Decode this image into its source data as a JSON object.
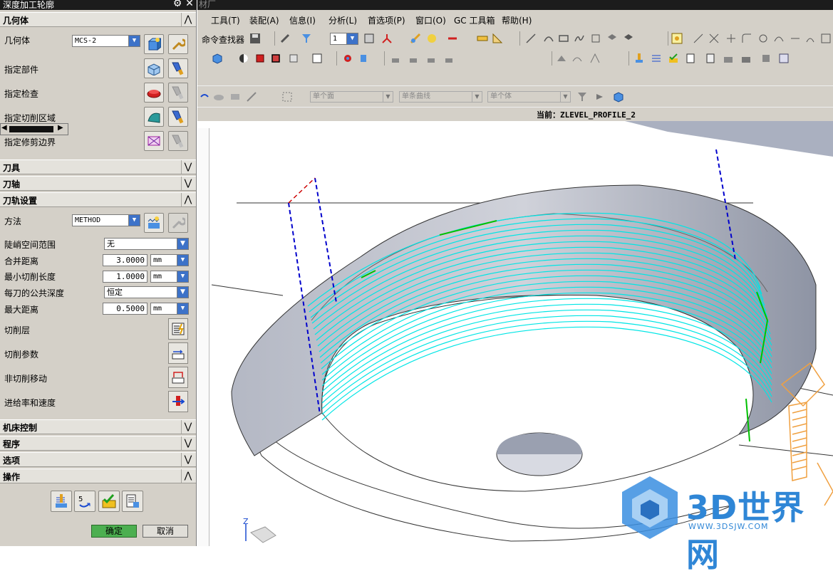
{
  "app": {
    "window_title": "材厂",
    "dialog_title": "深度加工轮廓"
  },
  "menu": [
    "工具(T)",
    "装配(A)",
    "信息(I)",
    "分析(L)",
    "首选项(P)",
    "窗口(O)",
    "GC 工具箱",
    "帮助(H)"
  ],
  "toolbar": {
    "command_finder": "命令查找器",
    "layer_value": "1",
    "selection_filters": [
      "单个面",
      "单条曲线",
      "单个体"
    ]
  },
  "status": {
    "current_operation": "当前：ZLEVEL_PROFILE_2"
  },
  "dialog": {
    "sections": {
      "geometry": "几何体",
      "tool": "刀具",
      "tool_axis": "刀轴",
      "path_settings": "刀轨设置",
      "machine_control": "机床控制",
      "program": "程序",
      "options": "选项",
      "actions": "操作"
    },
    "geometry": {
      "label": "几何体",
      "value": "MCS-2",
      "specify_part": "指定部件",
      "specify_check": "指定检查",
      "specify_cut_area": "指定切削区域",
      "specify_trim_boundary": "指定修剪边界"
    },
    "path_settings": {
      "method_label": "方法",
      "method_value": "METHOD",
      "steep_range_label": "陡峭空间范围",
      "steep_range_value": "无",
      "merge_distance_label": "合并距离",
      "merge_distance_value": "3.0000",
      "merge_distance_unit": "mm",
      "min_cut_length_label": "最小切削长度",
      "min_cut_length_value": "1.0000",
      "min_cut_length_unit": "mm",
      "common_depth_label": "每刀的公共深度",
      "common_depth_value": "恒定",
      "max_distance_label": "最大距离",
      "max_distance_value": "0.5000",
      "max_distance_unit": "mm",
      "cut_levels": "切削层",
      "cut_parameters": "切削参数",
      "non_cutting_moves": "非切削移动",
      "feeds_speeds": "进给率和速度"
    },
    "ok": "确定",
    "cancel": "取消"
  },
  "viewport": {
    "axis_label": "Z"
  },
  "watermark": {
    "brand": "3D世界网",
    "url": "WWW.3DSJW.COM"
  },
  "colors": {
    "toolpath": "#00e5e5",
    "engage": "#0000cc",
    "tool": "#f0a040",
    "part_wall": "#9aa0b0",
    "ok_button": "#4caf50"
  }
}
